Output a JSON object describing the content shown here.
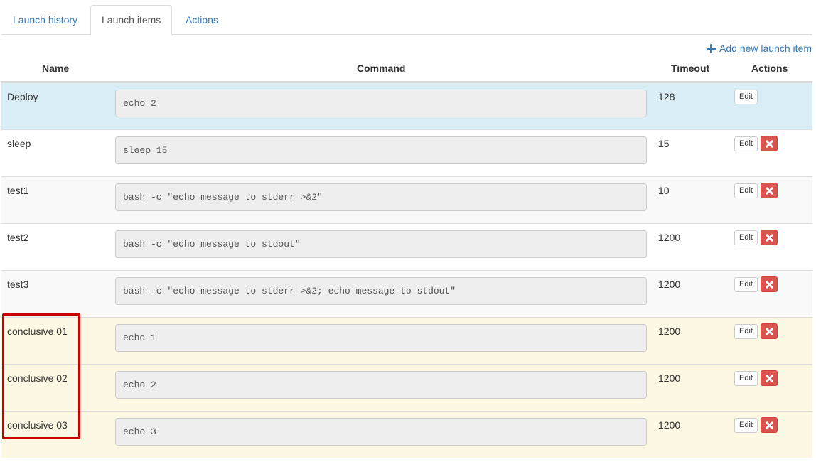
{
  "tabs": [
    {
      "label": "Launch history",
      "active": false
    },
    {
      "label": "Launch items",
      "active": true
    },
    {
      "label": "Actions",
      "active": false
    }
  ],
  "add_link": {
    "label": "Add new launch item",
    "icon": "plus-icon"
  },
  "table": {
    "headers": {
      "name": "Name",
      "command": "Command",
      "timeout": "Timeout",
      "actions": "Actions"
    },
    "rows": [
      {
        "name": "Deploy",
        "command": "echo 2",
        "timeout": "128",
        "edit_label": "Edit",
        "deletable": false,
        "style": "info"
      },
      {
        "name": "sleep",
        "command": "sleep 15",
        "timeout": "15",
        "edit_label": "Edit",
        "deletable": true,
        "style": "plain"
      },
      {
        "name": "test1",
        "command": "bash -c \"echo message to stderr >&2\"",
        "timeout": "10",
        "edit_label": "Edit",
        "deletable": true,
        "style": "striped"
      },
      {
        "name": "test2",
        "command": "bash -c \"echo message to stdout\"",
        "timeout": "1200",
        "edit_label": "Edit",
        "deletable": true,
        "style": "plain"
      },
      {
        "name": "test3",
        "command": "bash -c \"echo message to stderr >&2; echo message to stdout\"",
        "timeout": "1200",
        "edit_label": "Edit",
        "deletable": true,
        "style": "striped"
      },
      {
        "name": "conclusive 01",
        "command": "echo 1",
        "timeout": "1200",
        "edit_label": "Edit",
        "deletable": true,
        "style": "warning"
      },
      {
        "name": "conclusive 02",
        "command": "echo 2",
        "timeout": "1200",
        "edit_label": "Edit",
        "deletable": true,
        "style": "warning"
      },
      {
        "name": "conclusive 03",
        "command": "echo 3",
        "timeout": "1200",
        "edit_label": "Edit",
        "deletable": true,
        "style": "warning"
      }
    ]
  },
  "colors": {
    "link": "#337ab7",
    "info_row": "#d9edf7",
    "warning_row": "#fcf8e3",
    "delete_button": "#d9534f",
    "highlight": "#cc0000"
  }
}
